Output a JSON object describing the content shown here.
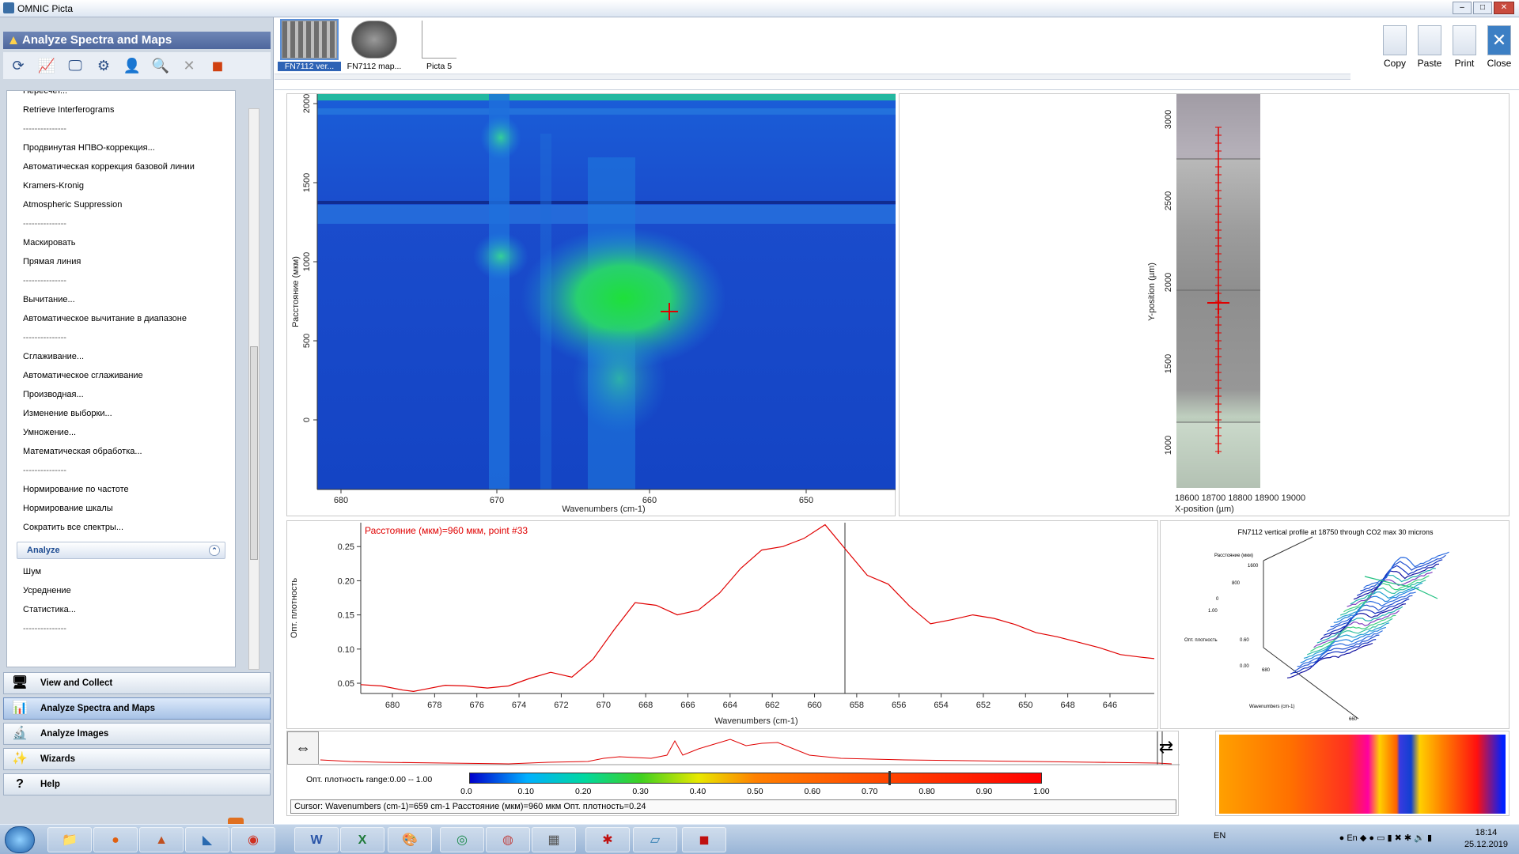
{
  "window": {
    "title": "OMNIC Picta"
  },
  "left_panel": {
    "header": "Analyze Spectra and Maps",
    "menu_items": [
      "Пересчет...",
      "Retrieve Interferograms",
      "---------------",
      "Продвинутая НПВО-коррекция...",
      "Автоматическая коррекция базовой линии",
      "Kramers-Kronig",
      "Atmospheric Suppression",
      "---------------",
      "Маскировать",
      "Прямая линия",
      "---------------",
      "Вычитание...",
      "Автоматическое вычитание в диапазоне",
      "---------------",
      "Сглаживание...",
      "Автоматическое сглаживание",
      "Производная...",
      "Изменение выборки...",
      "Умножение...",
      "Математическая обработка...",
      "---------------",
      "Нормирование по частоте",
      "Нормирование шкалы",
      "Сократить все спектры..."
    ],
    "group": {
      "label": "Analyze",
      "items": [
        "Шум",
        "Усреднение",
        "Статистика...",
        "---------------"
      ]
    },
    "nav": [
      "View and Collect",
      "Analyze Spectra and Maps",
      "Analyze Images",
      "Wizards",
      "Help"
    ]
  },
  "thumbs": [
    "FN7112 ver...",
    "FN7112 map...",
    "Picta 5"
  ],
  "right_buttons": [
    "Copy",
    "Paste",
    "Print",
    "Close"
  ],
  "map": {
    "y_ticks": [
      "2000",
      "1500",
      "1000",
      "500",
      "0"
    ],
    "y_label": "Расстояние (мкм)",
    "x_ticks": [
      "680",
      "670",
      "660",
      "650"
    ],
    "x_label": "Wavenumbers (cm-1)"
  },
  "image_panel": {
    "y_ticks": [
      "3000",
      "2500",
      "2000",
      "1500",
      "1000"
    ],
    "y_label": "Y-position (µm)",
    "x_ticks": "18600 18700 18800 18900 19000",
    "x_label": "X-position (µm)"
  },
  "spectrum": {
    "annotation": "Расстояние (мкм)=960 мкм, point #33",
    "y_label": "Опт. плотность",
    "y_ticks": [
      "0.25",
      "0.20",
      "0.15",
      "0.10",
      "0.05"
    ],
    "x_ticks": [
      "680",
      "678",
      "676",
      "674",
      "672",
      "670",
      "668",
      "666",
      "664",
      "662",
      "660",
      "658",
      "656",
      "654",
      "652",
      "650",
      "648",
      "646"
    ],
    "x_label": "Wavenumbers (cm-1)"
  },
  "plot3d": {
    "title": "FN7112 vertical profile at 18750 through CO2 max 30 microns",
    "labels": [
      "Расстояние (мкм)",
      "1600",
      "800",
      "0",
      "1.00",
      "Опт. плотность",
      "0.60",
      "0.00",
      "Wavenumbers (cm-1)",
      "680",
      "660"
    ]
  },
  "colorbar": {
    "range_label": "Опт. плотность range:0.00 -- 1.00",
    "ticks": [
      "0.0",
      "0.10",
      "0.20",
      "0.30",
      "0.40",
      "0.50",
      "0.60",
      "0.70",
      "0.80",
      "0.90",
      "1.00"
    ],
    "colors": [
      "#0000cc",
      "#00b0ff",
      "#00d8a0",
      "#40d020",
      "#e8e800",
      "#ff8000",
      "#ff0000"
    ]
  },
  "status": "Cursor: Wavenumbers (cm-1)=659 cm-1  Расстояние (мкм)=960 мкм  Опт. плотность=0.24",
  "taskbar": {
    "lang": "EN",
    "time": "18:14",
    "date": "25.12.2019",
    "tray_lang": "En"
  },
  "chart_data": {
    "type": "line",
    "title": "Расстояние (мкм)=960 мкм, point #33",
    "xlabel": "Wavenumbers (cm-1)",
    "ylabel": "Опт. плотность",
    "xlim": [
      681.5,
      643.9
    ],
    "ylim": [
      0.035,
      0.285
    ],
    "x": [
      681.5,
      680.5,
      679.5,
      679,
      678.5,
      677.5,
      676.5,
      675.5,
      674.5,
      673.5,
      672.5,
      671.5,
      670.5,
      669.5,
      668.5,
      667.5,
      666.5,
      665.5,
      664.5,
      663.5,
      662.5,
      661.5,
      660.5,
      659.5,
      658.5,
      657.5,
      656.5,
      655.5,
      654.5,
      653.5,
      652.5,
      651.5,
      650.5,
      649.5,
      648.5,
      647.5,
      646.5,
      645.5,
      644.5,
      643.9
    ],
    "y": [
      0.048,
      0.046,
      0.04,
      0.038,
      0.041,
      0.047,
      0.046,
      0.043,
      0.046,
      0.057,
      0.066,
      0.059,
      0.085,
      0.128,
      0.168,
      0.164,
      0.15,
      0.157,
      0.182,
      0.218,
      0.245,
      0.25,
      0.262,
      0.282,
      0.245,
      0.208,
      0.195,
      0.163,
      0.137,
      0.143,
      0.15,
      0.145,
      0.136,
      0.124,
      0.118,
      0.11,
      0.102,
      0.092,
      0.088,
      0.086
    ]
  }
}
